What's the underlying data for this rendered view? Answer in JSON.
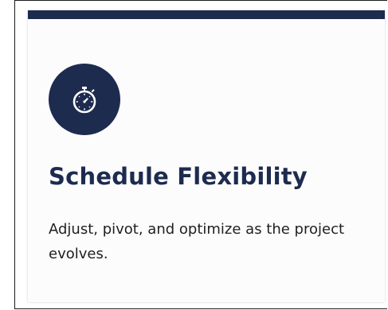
{
  "card": {
    "accent_color": "#1d2b4f",
    "icon": "stopwatch-icon",
    "title": "Schedule Flexibility",
    "description": "Adjust, pivot, and optimize as the project evolves."
  }
}
